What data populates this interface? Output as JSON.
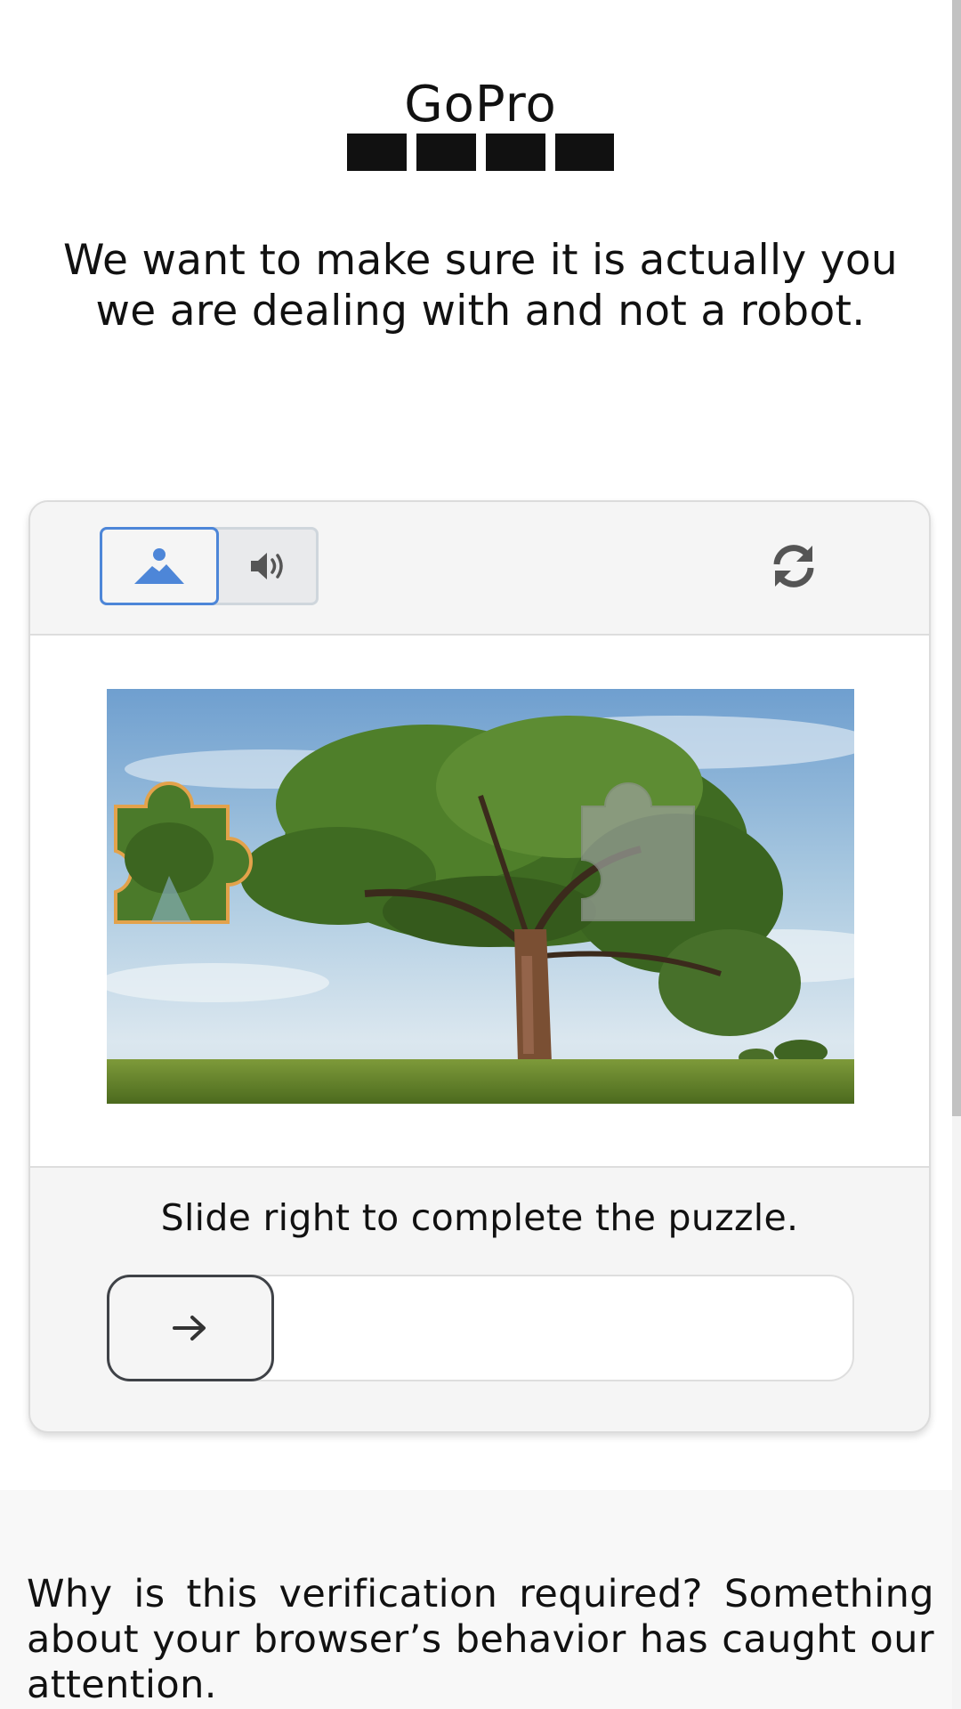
{
  "brand": {
    "logo_text": "GoPro",
    "logo_color": "#111111"
  },
  "headline": "We want to make sure it is actually you we are dealing with and not a robot.",
  "captcha": {
    "mode_image_icon": "image-mountain-icon",
    "mode_audio_icon": "speaker-icon",
    "refresh_icon": "refresh-icon",
    "selected_mode": "image",
    "accent_color": "#4d86d8",
    "piece_outline_color": "#e3a24b",
    "puzzle_image": "tree-landscape-with-puzzle-piece",
    "instruction": "Slide right to complete the puzzle.",
    "slider_icon": "arrow-right-icon",
    "slider_progress": 0
  },
  "footer": {
    "text": "Why is this verification required? Something about your browser’s behavior has caught our attention."
  }
}
